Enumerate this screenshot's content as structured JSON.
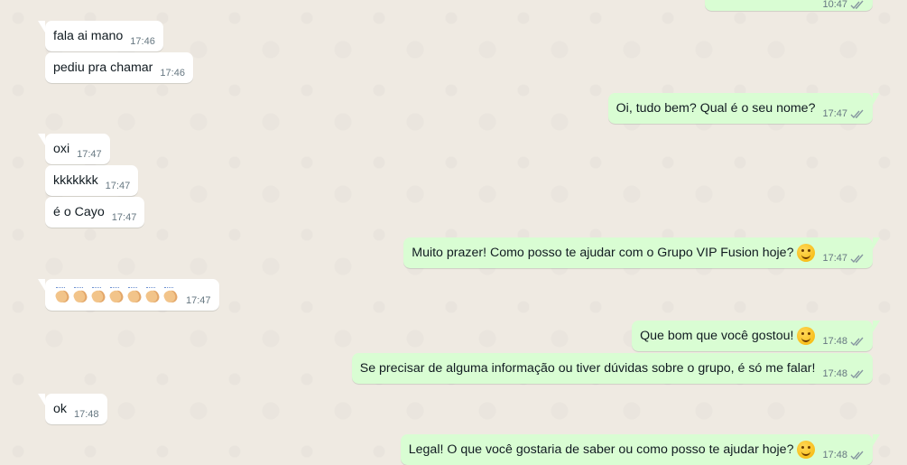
{
  "chat": {
    "top_partial": {
      "time": "10:47"
    },
    "messages": [
      {
        "dir": "in",
        "text": "fala ai mano",
        "time": "17:46"
      },
      {
        "dir": "in",
        "text": "pediu pra chamar",
        "time": "17:46"
      },
      {
        "dir": "out",
        "text": "Oi, tudo bem? Qual é o seu nome?",
        "time": "17:47"
      },
      {
        "dir": "in",
        "text": "oxi",
        "time": "17:47"
      },
      {
        "dir": "in",
        "text": "kkkkkkk",
        "time": "17:47"
      },
      {
        "dir": "in",
        "text": "é o Cayo",
        "time": "17:47"
      },
      {
        "dir": "out",
        "text": "Muito prazer! Como posso te ajudar com o Grupo VIP Fusion hoje?",
        "emoji": "smiling-face-icon",
        "time": "17:47"
      },
      {
        "dir": "in",
        "emoji": "clapping-hands-x7",
        "time": "17:47"
      },
      {
        "dir": "out",
        "text": "Que bom que você gostou!",
        "emoji": "grinning-face-icon",
        "time": "17:48"
      },
      {
        "dir": "out",
        "text": "Se precisar de alguma informação ou tiver dúvidas sobre o grupo, é só me falar!",
        "time": "17:48"
      },
      {
        "dir": "in",
        "text": "ok",
        "time": "17:48"
      },
      {
        "dir": "out",
        "text": "Legal! O que você gostaria de saber ou como posso te ajudar hoje?",
        "emoji": "smiling-face-icon",
        "time": "17:48"
      }
    ]
  },
  "colors": {
    "background": "#efeae2",
    "incoming_bubble": "#ffffff",
    "outgoing_bubble": "#d9fdd3",
    "read_ticks": "#8696a0"
  }
}
